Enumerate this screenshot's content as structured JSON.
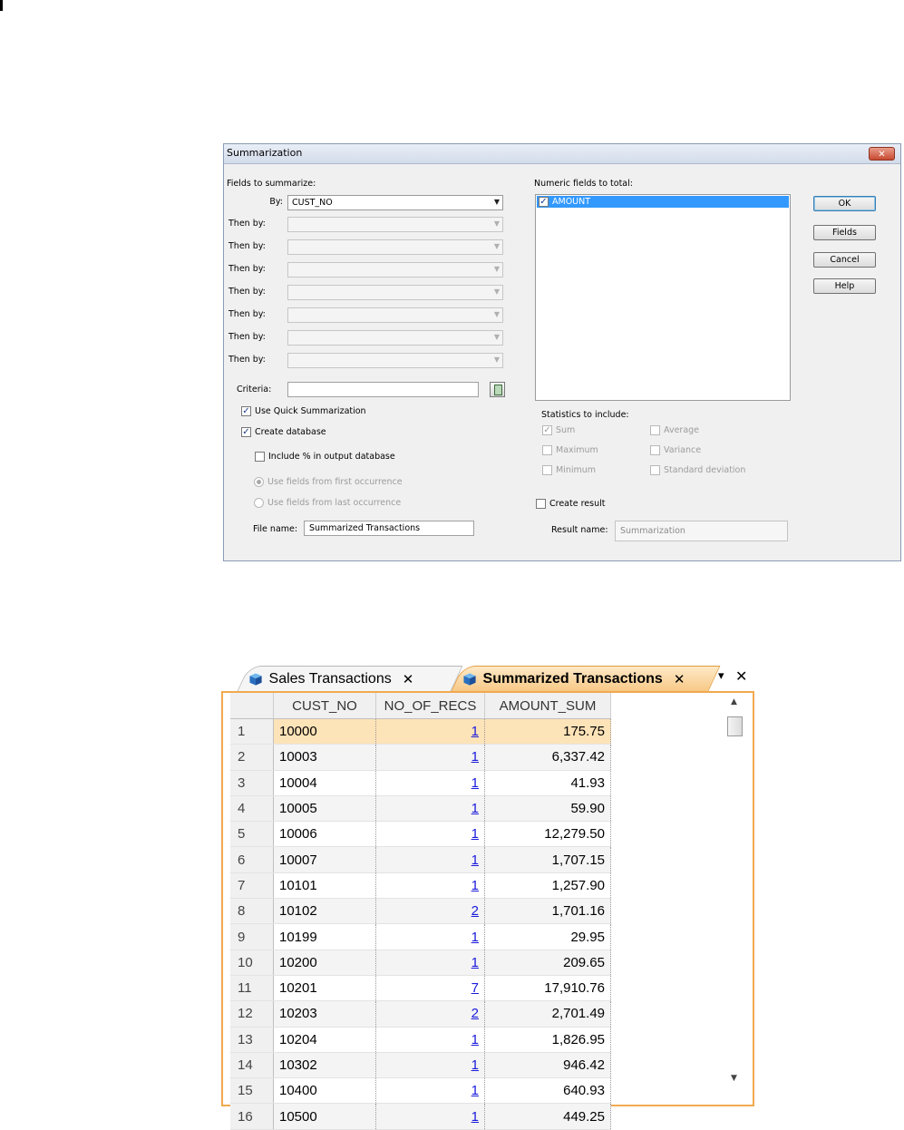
{
  "dialog": {
    "title": "Summarization",
    "close_label": "✕",
    "fields_label": "Fields to summarize:",
    "by_label": "By:",
    "by_value": "CUST_NO",
    "then_by_label": "Then by:",
    "criteria_label": "Criteria:",
    "criteria_value": "",
    "quick_summarization_label": "Use Quick Summarization",
    "create_database_label": "Create database",
    "include_pct_label": "Include % in output database",
    "first_occurrence_label": "Use fields from first occurrence",
    "last_occurrence_label": "Use fields from last occurrence",
    "file_name_label": "File name:",
    "file_name_value": "Summarized Transactions",
    "numeric_fields_label": "Numeric fields to total:",
    "numeric_fields": [
      "AMOUNT"
    ],
    "statistics_label": "Statistics to include:",
    "stats": {
      "sum": "Sum",
      "maximum": "Maximum",
      "minimum": "Minimum",
      "average": "Average",
      "variance": "Variance",
      "std_dev": "Standard deviation"
    },
    "create_result_label": "Create result",
    "result_name_label": "Result name:",
    "result_name_value": "Summarization",
    "buttons": {
      "ok": "OK",
      "fields": "Fields",
      "cancel": "Cancel",
      "help": "Help"
    }
  },
  "grid_window": {
    "tabs": [
      {
        "label": "Sales Transactions",
        "close": "✕"
      },
      {
        "label": "Summarized Transactions",
        "close": "✕"
      }
    ],
    "pin_label": "▾",
    "close_label": "✕",
    "columns": [
      "CUST_NO",
      "NO_OF_RECS",
      "AMOUNT_SUM"
    ],
    "rows": [
      {
        "n": "1",
        "cust": "10000",
        "recs": "1",
        "sum": "175.75"
      },
      {
        "n": "2",
        "cust": "10003",
        "recs": "1",
        "sum": "6,337.42"
      },
      {
        "n": "3",
        "cust": "10004",
        "recs": "1",
        "sum": "41.93"
      },
      {
        "n": "4",
        "cust": "10005",
        "recs": "1",
        "sum": "59.90"
      },
      {
        "n": "5",
        "cust": "10006",
        "recs": "1",
        "sum": "12,279.50"
      },
      {
        "n": "6",
        "cust": "10007",
        "recs": "1",
        "sum": "1,707.15"
      },
      {
        "n": "7",
        "cust": "10101",
        "recs": "1",
        "sum": "1,257.90"
      },
      {
        "n": "8",
        "cust": "10102",
        "recs": "2",
        "sum": "1,701.16"
      },
      {
        "n": "9",
        "cust": "10199",
        "recs": "1",
        "sum": "29.95"
      },
      {
        "n": "10",
        "cust": "10200",
        "recs": "1",
        "sum": "209.65"
      },
      {
        "n": "11",
        "cust": "10201",
        "recs": "7",
        "sum": "17,910.76"
      },
      {
        "n": "12",
        "cust": "10203",
        "recs": "2",
        "sum": "2,701.49"
      },
      {
        "n": "13",
        "cust": "10204",
        "recs": "1",
        "sum": "1,826.95"
      },
      {
        "n": "14",
        "cust": "10302",
        "recs": "1",
        "sum": "946.42"
      },
      {
        "n": "15",
        "cust": "10400",
        "recs": "1",
        "sum": "640.93"
      },
      {
        "n": "16",
        "cust": "10500",
        "recs": "1",
        "sum": "449.25"
      }
    ]
  },
  "colors": {
    "accent": "#f1a94f",
    "selection": "#3399ff",
    "selected_row": "#fde3b8"
  }
}
